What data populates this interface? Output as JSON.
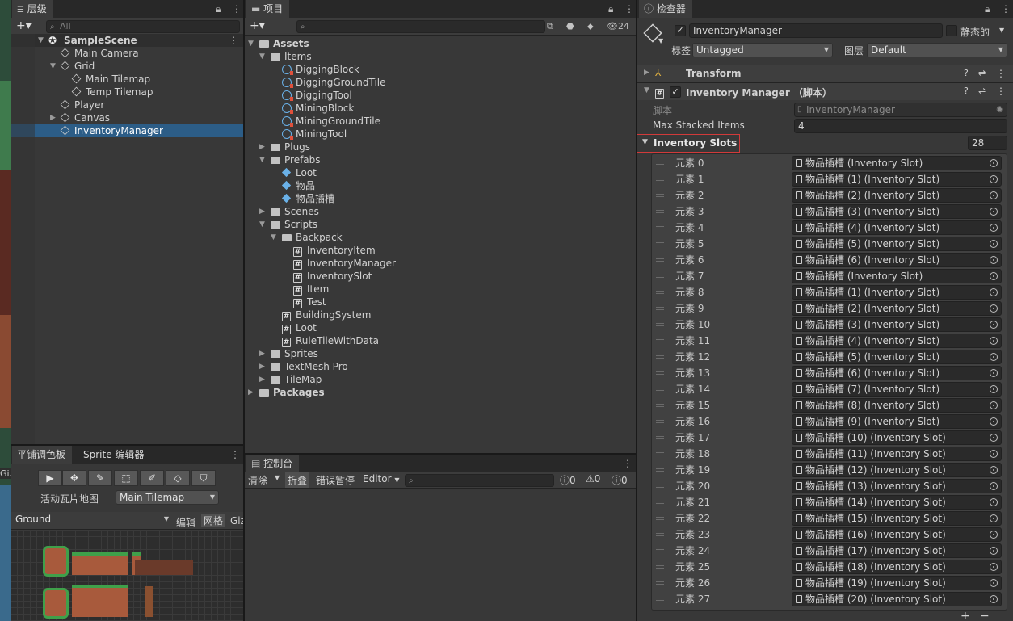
{
  "hierarchy": {
    "tab": "层级",
    "search_placeholder": "All",
    "scene": "SampleScene",
    "items": [
      "Main Camera",
      "Grid",
      "Main Tilemap",
      "Temp Tilemap",
      "Player",
      "Canvas",
      "InventoryManager"
    ]
  },
  "palette": {
    "tab1": "平铺调色板",
    "tab2": "Sprite 编辑器",
    "active_tilemap_label": "活动瓦片地图",
    "active_tilemap_value": "Main Tilemap",
    "palette_value": "Ground",
    "edit_btn": "编辑",
    "grid_btn": "网格",
    "giz_btn": "Giz",
    "tools": [
      "▶",
      "✥",
      "✎",
      "⬚",
      "✐",
      "◇",
      "⛉"
    ]
  },
  "scene_edge_label": "Giz",
  "project": {
    "tab": "项目",
    "hidden_count": "24",
    "tree": [
      {
        "label": "Assets",
        "depth": 0,
        "kind": "folder",
        "expanded": true,
        "bold": true
      },
      {
        "label": "Items",
        "depth": 1,
        "kind": "folder",
        "expanded": true
      },
      {
        "label": "DiggingBlock",
        "depth": 2,
        "kind": "tile"
      },
      {
        "label": "DiggingGroundTile",
        "depth": 2,
        "kind": "tile"
      },
      {
        "label": "DiggingTool",
        "depth": 2,
        "kind": "tile"
      },
      {
        "label": "MiningBlock",
        "depth": 2,
        "kind": "tile"
      },
      {
        "label": "MiningGroundTile",
        "depth": 2,
        "kind": "tile"
      },
      {
        "label": "MiningTool",
        "depth": 2,
        "kind": "tile"
      },
      {
        "label": "Plugs",
        "depth": 1,
        "kind": "folder",
        "expanded": false
      },
      {
        "label": "Prefabs",
        "depth": 1,
        "kind": "folder",
        "expanded": true
      },
      {
        "label": "Loot",
        "depth": 2,
        "kind": "prefab"
      },
      {
        "label": "物品",
        "depth": 2,
        "kind": "prefab"
      },
      {
        "label": "物品插槽",
        "depth": 2,
        "kind": "prefab"
      },
      {
        "label": "Scenes",
        "depth": 1,
        "kind": "folder",
        "expanded": false
      },
      {
        "label": "Scripts",
        "depth": 1,
        "kind": "folder",
        "expanded": true
      },
      {
        "label": "Backpack",
        "depth": 2,
        "kind": "folder",
        "expanded": true
      },
      {
        "label": "InventoryItem",
        "depth": 3,
        "kind": "script"
      },
      {
        "label": "InventoryManager",
        "depth": 3,
        "kind": "script"
      },
      {
        "label": "InventorySlot",
        "depth": 3,
        "kind": "script"
      },
      {
        "label": "Item",
        "depth": 3,
        "kind": "script"
      },
      {
        "label": "Test",
        "depth": 3,
        "kind": "script"
      },
      {
        "label": "BuildingSystem",
        "depth": 2,
        "kind": "script"
      },
      {
        "label": "Loot",
        "depth": 2,
        "kind": "script"
      },
      {
        "label": "RuleTileWithData",
        "depth": 2,
        "kind": "script"
      },
      {
        "label": "Sprites",
        "depth": 1,
        "kind": "folder",
        "expanded": false
      },
      {
        "label": "TextMesh Pro",
        "depth": 1,
        "kind": "folder",
        "expanded": false
      },
      {
        "label": "TileMap",
        "depth": 1,
        "kind": "folder",
        "expanded": false
      },
      {
        "label": "Packages",
        "depth": 0,
        "kind": "folder",
        "expanded": false,
        "bold": true
      }
    ]
  },
  "console": {
    "tab": "控制台",
    "clear": "清除",
    "collapse": "折叠",
    "error_pause": "错误暂停",
    "editor": "Editor",
    "count_log": "0",
    "count_warn": "0",
    "count_err": "0"
  },
  "inspector": {
    "tab": "检查器",
    "object_name": "InventoryManager",
    "static_label": "静态的",
    "tag_label": "标签",
    "tag_value": "Untagged",
    "layer_label": "图层",
    "layer_value": "Default",
    "transform": "Transform",
    "component": "Inventory Manager （脚本）",
    "script_label": "脚本",
    "script_value": "InventoryManager",
    "max_stacked_label": "Max Stacked Items",
    "max_stacked_value": "4",
    "slots_label": "Inventory Slots",
    "slots_count": "28",
    "slots": [
      {
        "el": "元素 0",
        "ref": "物品插槽 (Inventory Slot)"
      },
      {
        "el": "元素 1",
        "ref": "物品插槽 (1) (Inventory Slot)"
      },
      {
        "el": "元素 2",
        "ref": "物品插槽 (2) (Inventory Slot)"
      },
      {
        "el": "元素 3",
        "ref": "物品插槽 (3) (Inventory Slot)"
      },
      {
        "el": "元素 4",
        "ref": "物品插槽 (4) (Inventory Slot)"
      },
      {
        "el": "元素 5",
        "ref": "物品插槽 (5) (Inventory Slot)"
      },
      {
        "el": "元素 6",
        "ref": "物品插槽 (6) (Inventory Slot)"
      },
      {
        "el": "元素 7",
        "ref": "物品插槽 (Inventory Slot)"
      },
      {
        "el": "元素 8",
        "ref": "物品插槽 (1) (Inventory Slot)"
      },
      {
        "el": "元素 9",
        "ref": "物品插槽 (2) (Inventory Slot)"
      },
      {
        "el": "元素 10",
        "ref": "物品插槽 (3) (Inventory Slot)"
      },
      {
        "el": "元素 11",
        "ref": "物品插槽 (4) (Inventory Slot)"
      },
      {
        "el": "元素 12",
        "ref": "物品插槽 (5) (Inventory Slot)"
      },
      {
        "el": "元素 13",
        "ref": "物品插槽 (6) (Inventory Slot)"
      },
      {
        "el": "元素 14",
        "ref": "物品插槽 (7) (Inventory Slot)"
      },
      {
        "el": "元素 15",
        "ref": "物品插槽 (8) (Inventory Slot)"
      },
      {
        "el": "元素 16",
        "ref": "物品插槽 (9) (Inventory Slot)"
      },
      {
        "el": "元素 17",
        "ref": "物品插槽 (10) (Inventory Slot)"
      },
      {
        "el": "元素 18",
        "ref": "物品插槽 (11) (Inventory Slot)"
      },
      {
        "el": "元素 19",
        "ref": "物品插槽 (12) (Inventory Slot)"
      },
      {
        "el": "元素 20",
        "ref": "物品插槽 (13) (Inventory Slot)"
      },
      {
        "el": "元素 21",
        "ref": "物品插槽 (14) (Inventory Slot)"
      },
      {
        "el": "元素 22",
        "ref": "物品插槽 (15) (Inventory Slot)"
      },
      {
        "el": "元素 23",
        "ref": "物品插槽 (16) (Inventory Slot)"
      },
      {
        "el": "元素 24",
        "ref": "物品插槽 (17) (Inventory Slot)"
      },
      {
        "el": "元素 25",
        "ref": "物品插槽 (18) (Inventory Slot)"
      },
      {
        "el": "元素 26",
        "ref": "物品插槽 (19) (Inventory Slot)"
      },
      {
        "el": "元素 27",
        "ref": "物品插槽 (20) (Inventory Slot)"
      }
    ],
    "add_btn": "+",
    "remove_btn": "−"
  },
  "colors": {
    "selection": "#2c5d87",
    "highlight_border": "#d23a3a",
    "accent_blue": "#6ab1e8"
  }
}
